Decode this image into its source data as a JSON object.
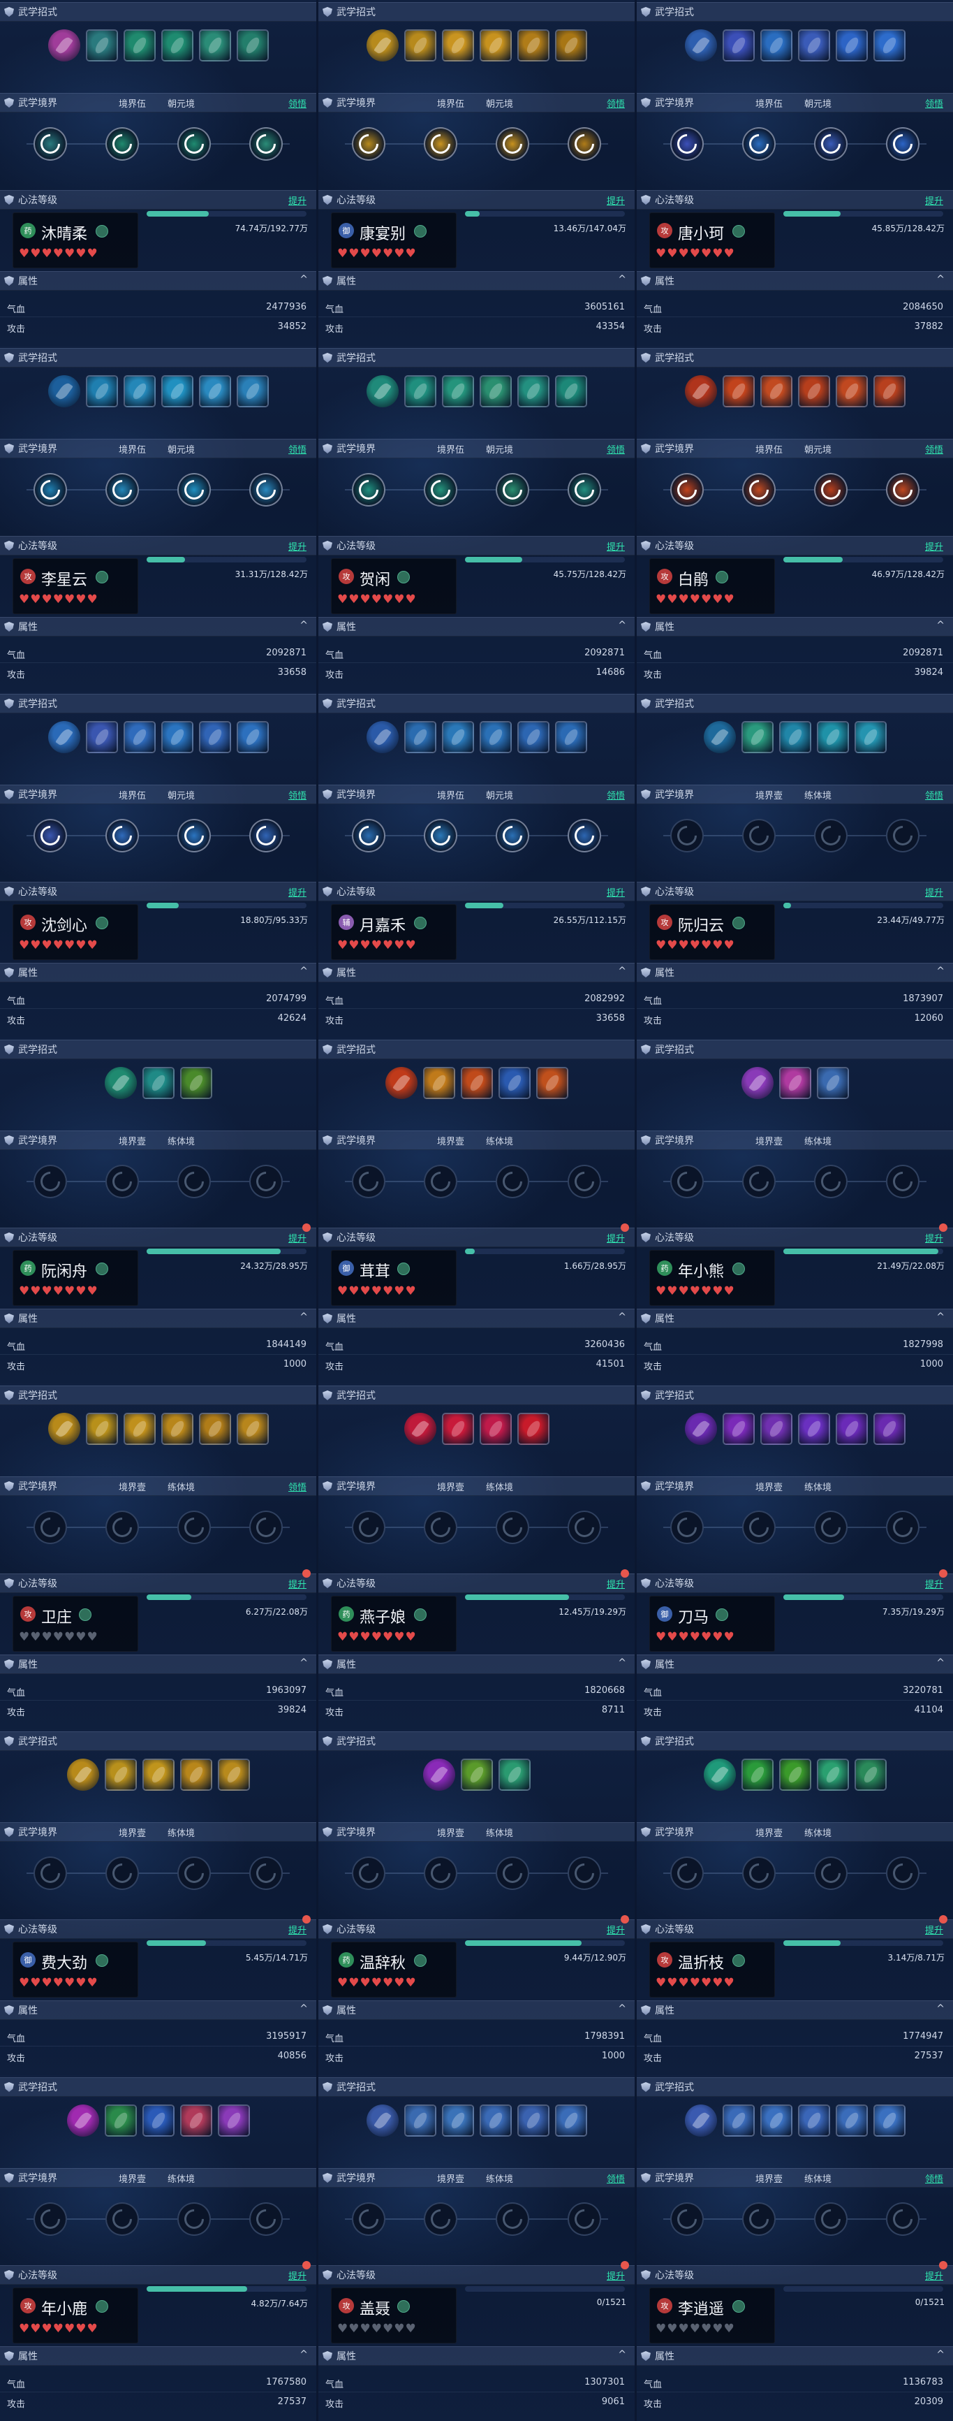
{
  "labels": {
    "moves": "武学招式",
    "realm": "武学境界",
    "heart": "心法等级",
    "upgrade": "提升",
    "attr": "属性",
    "enlight": "领悟",
    "hp": "气血",
    "atk": "攻击"
  },
  "colors": {
    "accent": "#2fe6b0",
    "heart": "#e44a4a",
    "bar": "#46bfa8"
  },
  "panels": [
    {
      "name": "沐晴柔",
      "badge": "药",
      "badge_color": "#2f8f5a",
      "realm1": "境界伍",
      "realm2": "朝元境",
      "enlight": true,
      "level": "74.74万/192.77万",
      "level_frac": 0.39,
      "hp": "2477936",
      "atk": "34852",
      "hearts": "♥♥♥♥♥♥♥",
      "hearts_dim": "",
      "dot": false,
      "icons": [
        "#a03c9a",
        "#2a7a7e",
        "#1f8a6e",
        "#1e8b70",
        "#2a8c77",
        "#237e6b"
      ],
      "nodes_on": true
    },
    {
      "name": "康宴别",
      "badge": "御",
      "badge_color": "#3a5fa8",
      "realm1": "境界伍",
      "realm2": "朝元境",
      "enlight": true,
      "level": "13.46万/147.04万",
      "level_frac": 0.09,
      "hp": "3605161",
      "atk": "43354",
      "hearts": "♥♥♥♥♥♥♥",
      "hearts_dim": "",
      "dot": false,
      "icons": [
        "#b78a1c",
        "#b78a1c",
        "#c99420",
        "#c7921e",
        "#b07c18",
        "#a87614"
      ],
      "nodes_on": true
    },
    {
      "name": "唐小珂",
      "badge": "攻",
      "badge_color": "#b63a3a",
      "realm1": "境界伍",
      "realm2": "朝元境",
      "enlight": true,
      "level": "45.85万/128.42万",
      "level_frac": 0.36,
      "hp": "2084650",
      "atk": "37882",
      "hearts": "♥♥♥♥♥♥♥",
      "hearts_dim": "",
      "dot": false,
      "icons": [
        "#2e5fb0",
        "#3b4fb8",
        "#2a6dc0",
        "#3a5bb8",
        "#2c64c6",
        "#2d6ccc"
      ],
      "nodes_on": true
    },
    {
      "name": "李星云",
      "badge": "攻",
      "badge_color": "#b63a3a",
      "realm1": "境界伍",
      "realm2": "朝元境",
      "enlight": true,
      "level": "31.31万/128.42万",
      "level_frac": 0.24,
      "hp": "2092871",
      "atk": "33658",
      "hearts": "♥♥♥♥♥♥♥",
      "hearts_dim": "",
      "dot": false,
      "icons": [
        "#1c5f9c",
        "#1f7fb0",
        "#2487b8",
        "#2090c0",
        "#2a8ac0",
        "#2a80b8"
      ],
      "nodes_on": true
    },
    {
      "name": "贺闲",
      "badge": "攻",
      "badge_color": "#b63a3a",
      "realm1": "境界伍",
      "realm2": "朝元境",
      "enlight": true,
      "level": "45.75万/128.42万",
      "level_frac": 0.36,
      "hp": "2092871",
      "atk": "14686",
      "hearts": "♥♥♥♥♥♥♥",
      "hearts_dim": "",
      "dot": false,
      "icons": [
        "#1f8a7a",
        "#1f8f7e",
        "#24947c",
        "#2a8f70",
        "#239080",
        "#1c8878"
      ],
      "nodes_on": true
    },
    {
      "name": "白鹃",
      "badge": "攻",
      "badge_color": "#b63a3a",
      "realm1": "境界伍",
      "realm2": "朝元境",
      "enlight": true,
      "level": "46.97万/128.42万",
      "level_frac": 0.37,
      "hp": "2092871",
      "atk": "39824",
      "hearts": "♥♥♥♥♥♥♥",
      "hearts_dim": "",
      "dot": false,
      "icons": [
        "#b0341c",
        "#c2431c",
        "#c24a20",
        "#b63e1c",
        "#c04820",
        "#b8401e"
      ],
      "nodes_on": true
    },
    {
      "name": "沈剑心",
      "badge": "攻",
      "badge_color": "#b63a3a",
      "realm1": "境界伍",
      "realm2": "朝元境",
      "enlight": true,
      "level": "18.80万/95.33万",
      "level_frac": 0.2,
      "hp": "2074799",
      "atk": "42624",
      "hearts": "♥♥♥♥♥♥♥",
      "hearts_dim": "",
      "dot": false,
      "icons": [
        "#2a6ab8",
        "#3a56b0",
        "#2f6bbc",
        "#2a74c0",
        "#3064b6",
        "#2c70be"
      ],
      "nodes_on": true
    },
    {
      "name": "月嘉禾",
      "badge": "辅",
      "badge_color": "#8a5cb0",
      "realm1": "境界伍",
      "realm2": "朝元境",
      "enlight": true,
      "level": "26.55万/112.15万",
      "level_frac": 0.24,
      "hp": "2082992",
      "atk": "33658",
      "hearts": "♥♥♥♥♥♥♥",
      "hearts_dim": "",
      "dot": false,
      "icons": [
        "#2a5aa8",
        "#2a6cb0",
        "#2a78b8",
        "#2a70b6",
        "#2c66b2",
        "#2a6ab4"
      ],
      "nodes_on": true
    },
    {
      "name": "阮归云",
      "badge": "攻",
      "badge_color": "#b63a3a",
      "realm1": "境界壹",
      "realm2": "练体境",
      "enlight": true,
      "level": "23.44万/49.77万",
      "level_frac": 0.05,
      "hp": "1873907",
      "atk": "12060",
      "hearts": "♥♥♥♥♥♥♥",
      "hearts_dim": "",
      "dot": false,
      "icons": [
        "#1e6a9c",
        "#2a9a7e",
        "#2086a8",
        "#1f92a8",
        "#2494b0"
      ],
      "nodes_on": false
    },
    {
      "name": "阮闲舟",
      "badge": "药",
      "badge_color": "#2f8f5a",
      "realm1": "境界壹",
      "realm2": "练体境",
      "enlight": false,
      "level": "24.32万/28.95万",
      "level_frac": 0.84,
      "hp": "1844149",
      "atk": "1000",
      "hearts": "♥♥♥♥♥♥♥",
      "hearts_dim": "",
      "dot": true,
      "icons": [
        "#1f8a70",
        "#1f8a86",
        "#4a8a2a"
      ],
      "nodes_on": false
    },
    {
      "name": "茸茸",
      "badge": "御",
      "badge_color": "#3a5fa8",
      "realm1": "境界壹",
      "realm2": "练体境",
      "enlight": false,
      "level": "1.66万/28.95万",
      "level_frac": 0.06,
      "hp": "3260436",
      "atk": "41501",
      "hearts": "♥♥♥♥♥♥♥",
      "hearts_dim": "",
      "dot": true,
      "icons": [
        "#c03a1a",
        "#c07a1a",
        "#c04a1a",
        "#2a5ab0",
        "#c0501c"
      ],
      "nodes_on": false
    },
    {
      "name": "年小熊",
      "badge": "药",
      "badge_color": "#2f8f5a",
      "realm1": "境界壹",
      "realm2": "练体境",
      "enlight": false,
      "level": "21.49万/22.08万",
      "level_frac": 0.97,
      "hp": "1827998",
      "atk": "1000",
      "hearts": "♥♥♥♥♥♥♥",
      "hearts_dim": "",
      "dot": true,
      "icons": [
        "#8a3ab8",
        "#b03aa0",
        "#3a6ab0"
      ],
      "nodes_on": false
    },
    {
      "name": "卫庄",
      "badge": "攻",
      "badge_color": "#b63a3a",
      "realm1": "境界壹",
      "realm2": "练体境",
      "enlight": true,
      "level": "6.27万/22.08万",
      "level_frac": 0.28,
      "hp": "1963097",
      "atk": "39824",
      "hearts": "",
      "hearts_dim": "♥♥♥♥♥♥♥",
      "dot": true,
      "icons": [
        "#b88a1a",
        "#b8901a",
        "#c0901c",
        "#b8861a",
        "#b07c18",
        "#b8861c"
      ],
      "nodes_on": false
    },
    {
      "name": "燕子娘",
      "badge": "药",
      "badge_color": "#2f8f5a",
      "realm1": "境界壹",
      "realm2": "练体境",
      "enlight": false,
      "level": "12.45万/19.29万",
      "level_frac": 0.65,
      "hp": "1820668",
      "atk": "8711",
      "hearts": "♥♥♥♥♥♥♥",
      "hearts_dim": "",
      "dot": true,
      "icons": [
        "#c01a3a",
        "#c81a3a",
        "#c01a4a",
        "#c81a2a"
      ],
      "nodes_on": false
    },
    {
      "name": "刀马",
      "badge": "御",
      "badge_color": "#3a5fa8",
      "realm1": "境界壹",
      "realm2": "练体境",
      "enlight": false,
      "level": "7.35万/19.29万",
      "level_frac": 0.38,
      "hp": "3220781",
      "atk": "41104",
      "hearts": "♥♥♥♥♥♥♥",
      "hearts_dim": "",
      "dot": true,
      "icons": [
        "#6a2ab0",
        "#7a2ab8",
        "#7030b0",
        "#6a30c0",
        "#6a2ab8",
        "#6a2ab0"
      ],
      "nodes_on": false
    },
    {
      "name": "费大劲",
      "badge": "御",
      "badge_color": "#3a5fa8",
      "realm1": "境界壹",
      "realm2": "练体境",
      "enlight": false,
      "level": "5.45万/14.71万",
      "level_frac": 0.37,
      "hp": "3195917",
      "atk": "40856",
      "hearts": "♥♥♥♥♥♥♥",
      "hearts_dim": "",
      "dot": true,
      "icons": [
        "#b88a1a",
        "#b8901c",
        "#c0941c",
        "#b8861a",
        "#b88a1c"
      ],
      "nodes_on": false
    },
    {
      "name": "温辞秋",
      "badge": "药",
      "badge_color": "#2f8f5a",
      "realm1": "境界壹",
      "realm2": "练体境",
      "enlight": false,
      "level": "9.44万/12.90万",
      "level_frac": 0.73,
      "hp": "1798391",
      "atk": "1000",
      "hearts": "♥♥♥♥♥♥♥",
      "hearts_dim": "",
      "dot": true,
      "icons": [
        "#8a2ab8",
        "#5a9a2a",
        "#2a9a70"
      ],
      "nodes_on": false
    },
    {
      "name": "温折枝",
      "badge": "攻",
      "badge_color": "#b63a3a",
      "realm1": "境界壹",
      "realm2": "练体境",
      "enlight": false,
      "level": "3.14万/8.71万",
      "level_frac": 0.36,
      "hp": "1774947",
      "atk": "27537",
      "hearts": "♥♥♥♥♥♥♥",
      "hearts_dim": "",
      "dot": true,
      "icons": [
        "#1f9a7a",
        "#2a9a3a",
        "#3a9a2a",
        "#2aa070",
        "#2a8a5a"
      ],
      "nodes_on": false
    },
    {
      "name": "年小鹿",
      "badge": "攻",
      "badge_color": "#b63a3a",
      "realm1": "境界壹",
      "realm2": "练体境",
      "enlight": false,
      "level": "4.82万/7.64万",
      "level_frac": 0.63,
      "hp": "1767580",
      "atk": "27537",
      "hearts": "♥♥♥♥♥♥♥",
      "hearts_dim": "",
      "dot": true,
      "icons": [
        "#a02ab0",
        "#2a8a4a",
        "#2a5ab8",
        "#b03a5a",
        "#8a3ab8"
      ],
      "nodes_on": false
    },
    {
      "name": "盖聂",
      "badge": "攻",
      "badge_color": "#b63a3a",
      "realm1": "境界壹",
      "realm2": "练体境",
      "enlight": true,
      "level": "0/1521",
      "level_frac": 0,
      "hp": "1307301",
      "atk": "9061",
      "hearts": "",
      "hearts_dim": "♥♥♥♥♥♥♥",
      "dot": true,
      "icons": [
        "#3a5aa8",
        "#3a6ab0",
        "#3a72b8",
        "#3a6ab6",
        "#3a62b0",
        "#3a6cb8"
      ],
      "nodes_on": false
    },
    {
      "name": "李逍遥",
      "badge": "攻",
      "badge_color": "#b63a3a",
      "realm1": "境界壹",
      "realm2": "练体境",
      "enlight": true,
      "level": "0/1521",
      "level_frac": 0,
      "hp": "1136783",
      "atk": "20309",
      "hearts": "",
      "hearts_dim": "♥♥♥♥♥♥♥",
      "dot": true,
      "icons": [
        "#3a5ab0",
        "#3a6ab8",
        "#3a70c0",
        "#3a66b8",
        "#3a6cba",
        "#3a70c0"
      ],
      "nodes_on": false
    }
  ]
}
